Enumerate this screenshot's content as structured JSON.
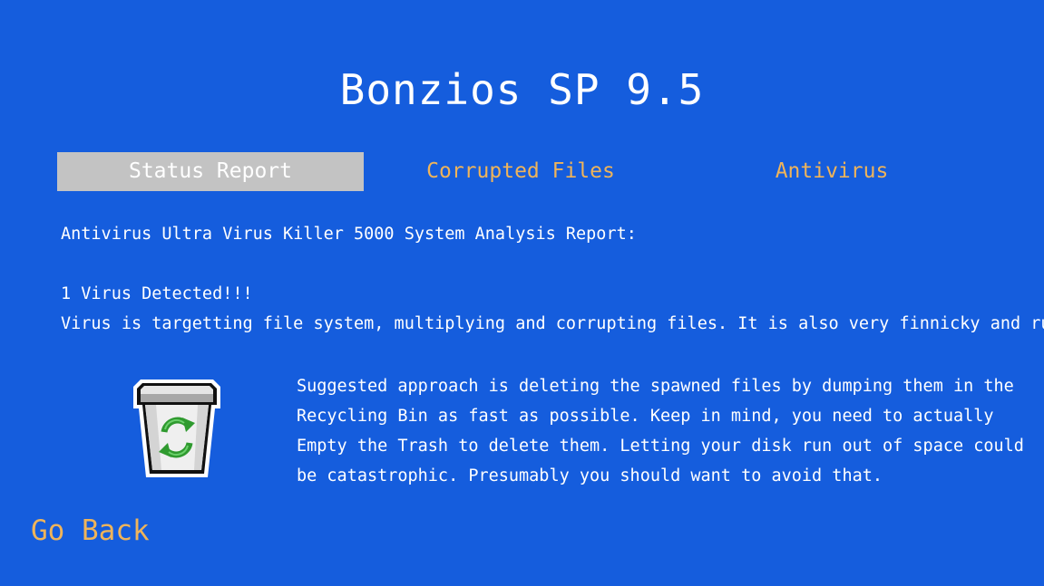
{
  "title": "Bonzios SP 9.5",
  "tabs": [
    {
      "label": "Status Report",
      "active": true
    },
    {
      "label": "Corrupted Files",
      "active": false
    },
    {
      "label": "Antivirus",
      "active": false
    }
  ],
  "report": {
    "heading": "Antivirus Ultra Virus Killer 5000 System Analysis Report:",
    "virus_count": "1 Virus Detected!!!",
    "virus_description": "Virus is targetting file system, multiplying and corrupting files. It is also very finnicky and rude.",
    "approach_lines": [
      "Suggested approach is deleting the spawned files by dumping them in the",
      "Recycling Bin as fast as possible. Keep in mind, you need to actually",
      "Empty the Trash to delete them. Letting your disk run out of space could",
      "be catastrophic. Presumably you should want to avoid that."
    ]
  },
  "icon": "recycle-bin-icon",
  "go_back_label": "Go Back",
  "colors": {
    "background": "#155ddd",
    "accent": "#efb45a",
    "active_tab": "#c3c3c3",
    "text": "#ffffff"
  }
}
